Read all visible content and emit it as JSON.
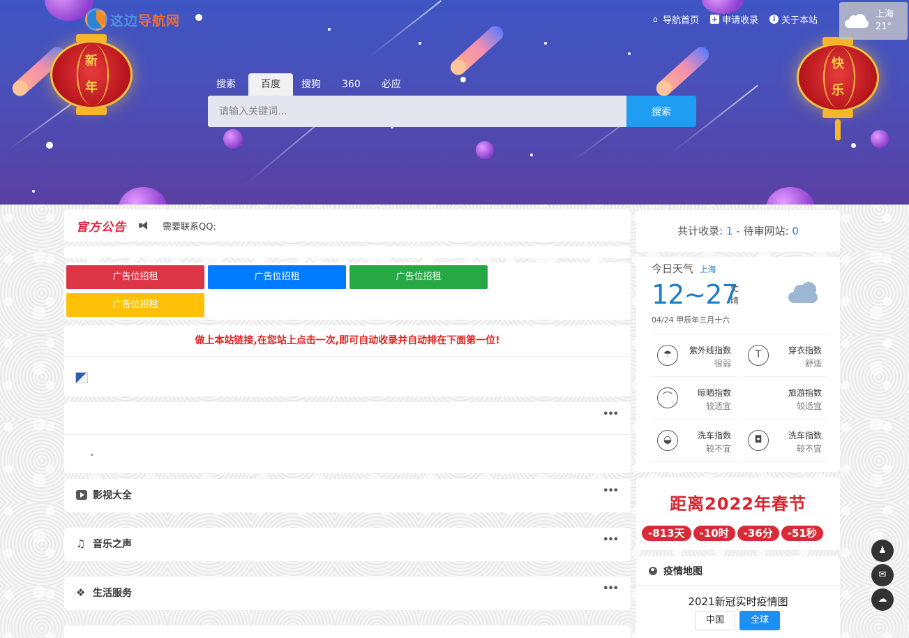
{
  "site": {
    "logo_part1": "这边",
    "logo_part2": "导航网"
  },
  "topnav": [
    {
      "label": "导航首页",
      "icon": "home-icon"
    },
    {
      "label": "申请收录",
      "icon": "plus-square-icon"
    },
    {
      "label": "关于本站",
      "icon": "info-circle-icon"
    }
  ],
  "weather_chip": {
    "city": "上海",
    "temp": "21°",
    "icon": "cloud-icon"
  },
  "lanterns": {
    "left": [
      "新",
      "年"
    ],
    "right": [
      "快",
      "乐"
    ]
  },
  "search": {
    "tabs": [
      "搜索",
      "百度",
      "搜狗",
      "360",
      "必应"
    ],
    "active_tab": "百度",
    "placeholder": "请输入关键词...",
    "button": "搜索"
  },
  "notice": {
    "title": "官方公告",
    "text": "需要联系QQ:"
  },
  "ads": [
    {
      "label": "广告位招租",
      "color": "#dc3545"
    },
    {
      "label": "广告位招租",
      "color": "#007bff"
    },
    {
      "label": "广告位招租",
      "color": "#28a745"
    },
    {
      "label": "广告位招租",
      "color": "#ffc107"
    }
  ],
  "promo": {
    "message": "做上本站链接,在您站上点击一次,即可自动收录并自动排在下面第一位!"
  },
  "more_label": "•••",
  "categories": [
    {
      "label": "影视大全",
      "icon": "video-icon"
    },
    {
      "label": "音乐之声",
      "icon": "music-icon"
    },
    {
      "label": "生活服务",
      "icon": "cubes-icon"
    }
  ],
  "stats": {
    "prefix": "共计收录:",
    "collected": "1",
    "sep": "- 待审网站:",
    "pending": "0"
  },
  "weather": {
    "title": "今日天气",
    "city": "上海",
    "temp_range": "12~27",
    "unit": "℃",
    "condition": "晴",
    "date": "04/24 甲辰年三月十六",
    "indices": [
      {
        "name": "紫外线指数",
        "value": "很弱",
        "icon": "umbrella-icon"
      },
      {
        "name": "穿衣指数",
        "value": "舒适",
        "icon": "shirt-icon"
      },
      {
        "name": "晾晒指数",
        "value": "较适宜",
        "icon": "hanger-icon"
      },
      {
        "name": "旅游指数",
        "value": "较适宜",
        "icon": "travel-icon"
      },
      {
        "name": "洗车指数",
        "value": "较不宜",
        "icon": "wash-icon"
      },
      {
        "name": "洗车指数",
        "value": "较不宜",
        "icon": "car-icon"
      }
    ]
  },
  "countdown": {
    "title": "距离2022年春节",
    "parts": [
      "-813天",
      "-10时",
      "-36分",
      "-51秒"
    ]
  },
  "epidemic": {
    "header": "疫情地图",
    "subtitle": "2021新冠实时疫情图",
    "buttons": [
      "中国",
      "全球"
    ],
    "active": "全球"
  },
  "float_buttons": [
    {
      "name": "qq-icon",
      "glyph": "♟"
    },
    {
      "name": "mail-icon",
      "glyph": "✉"
    },
    {
      "name": "wechat-icon",
      "glyph": "☁"
    }
  ]
}
